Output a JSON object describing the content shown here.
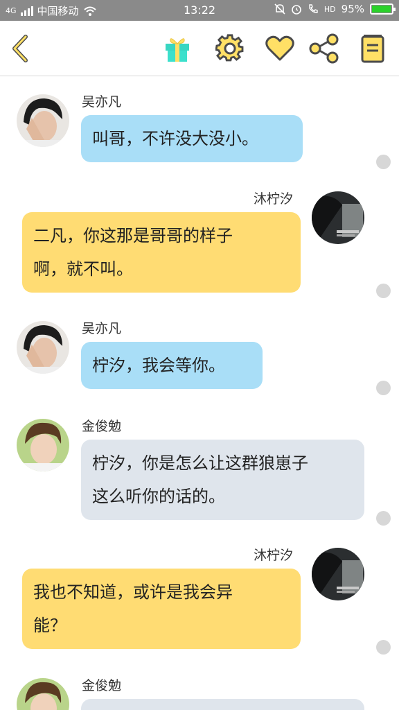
{
  "status_bar": {
    "signal_tag": "4G",
    "carrier": "中国移动",
    "time": "13:22",
    "hd_tag": "HD",
    "battery_percent": "95%",
    "battery_level": 0.95
  },
  "toolbar": {
    "icons": [
      "back-icon",
      "gift-icon",
      "settings-icon",
      "heart-icon",
      "share-icon",
      "notebook-icon"
    ],
    "accent_color": "#ffe066",
    "stroke_color": "#4a4a4a"
  },
  "colors": {
    "blue_bubble": "#a9def7",
    "yellow_bubble": "#ffdc73",
    "grey_bubble": "#dfe5ec"
  },
  "messages": [
    {
      "sender": "吴亦凡",
      "text": "叫哥，不许没大没小。",
      "side": "left",
      "style": "blue"
    },
    {
      "sender": "沐柠汐",
      "line1": "二凡，你这那是哥哥的样子",
      "line2": "啊，就不叫。",
      "side": "right",
      "style": "yellow"
    },
    {
      "sender": "吴亦凡",
      "text": "柠汐，我会等你。",
      "side": "left",
      "style": "blue"
    },
    {
      "sender": "金俊勉",
      "line1": "柠汐，你是怎么让这群狼崽子",
      "line2": "这么听你的话的。",
      "side": "left",
      "style": "grey"
    },
    {
      "sender": "沐柠汐",
      "line1": "我也不知道，或许是我会异",
      "line2": "能？",
      "side": "right",
      "style": "yellow"
    },
    {
      "sender": "金俊勉",
      "text": "",
      "side": "left",
      "style": "grey"
    }
  ]
}
